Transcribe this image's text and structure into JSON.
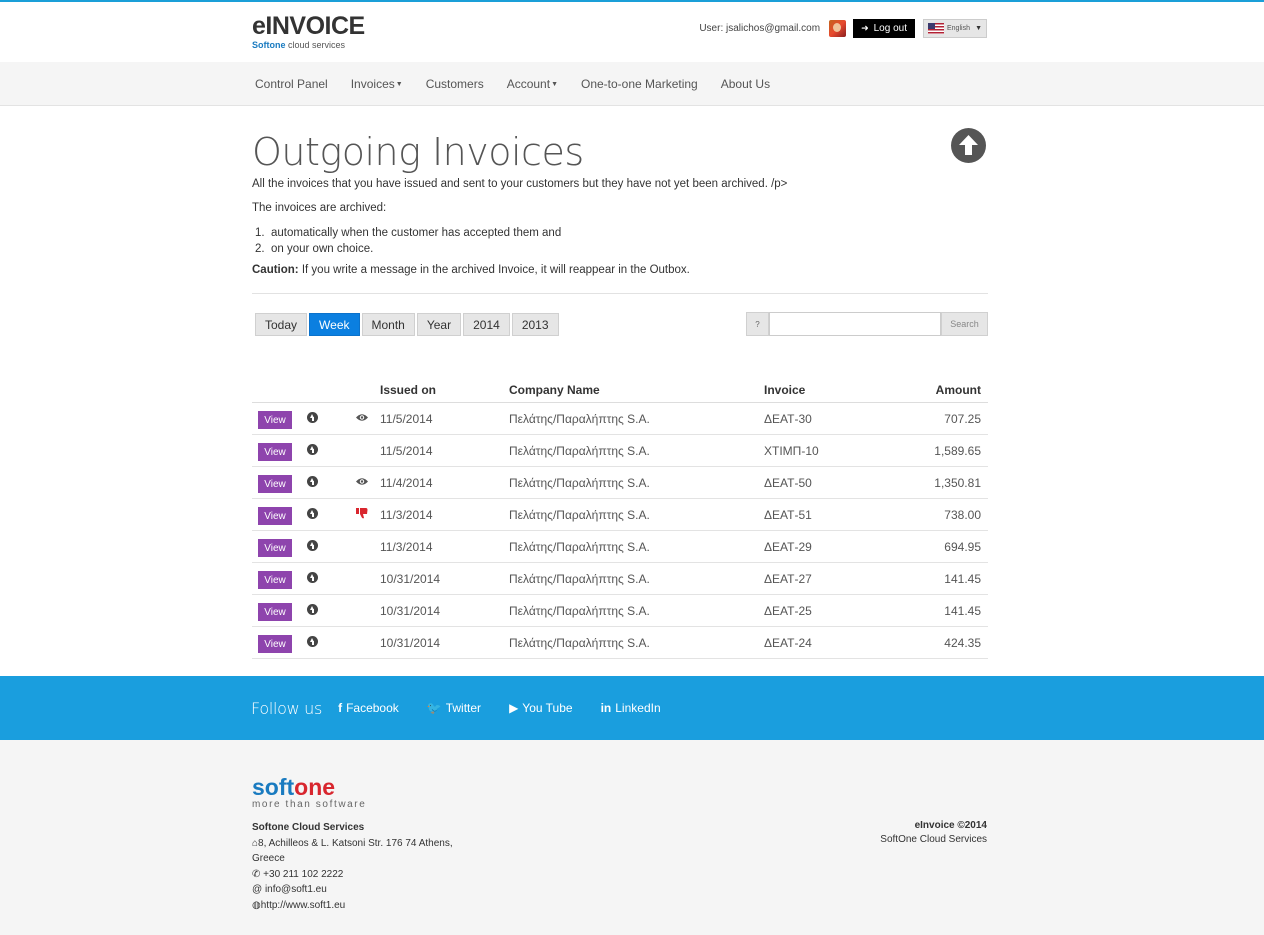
{
  "header": {
    "logo_main": "eINVOICE",
    "logo_sub_brand": "Softone",
    "logo_sub_text": "cloud services",
    "user_label": "User: jsalichos@gmail.com",
    "logout_label": "Log out",
    "language": "English"
  },
  "nav": {
    "items": [
      {
        "label": "Control Panel",
        "dropdown": false
      },
      {
        "label": "Invoices",
        "dropdown": true
      },
      {
        "label": "Customers",
        "dropdown": false
      },
      {
        "label": "Account",
        "dropdown": true
      },
      {
        "label": "One-to-one Marketing",
        "dropdown": false
      },
      {
        "label": "About Us",
        "dropdown": false
      }
    ]
  },
  "page": {
    "title": "Outgoing Invoices",
    "intro": "All the invoices that you have issued and sent to your customers but they have not yet been archived. /p>",
    "archived_intro": "The invoices are archived:",
    "list": [
      {
        "num": "1.",
        "text": "automatically when the customer has accepted them and"
      },
      {
        "num": "2.",
        "text": "on your own choice."
      }
    ],
    "caution_label": "Caution:",
    "caution_text": " If you write a message in the archived Invoice, it will reappear in the Outbox."
  },
  "filters": {
    "buttons": [
      "Today",
      "Week",
      "Month",
      "Year",
      "2014",
      "2013"
    ],
    "active": "Week",
    "help_label": "?",
    "search_value": "",
    "search_button": "Search"
  },
  "table": {
    "headers": {
      "issued_on": "Issued on",
      "company": "Company Name",
      "invoice": "Invoice",
      "amount": "Amount"
    },
    "view_label": "View",
    "rows": [
      {
        "status": "viewed",
        "date": "11/5/2014",
        "company": "Πελάτης/Παραλήπτης S.A.",
        "invoice": "ΔΕΑΤ-30",
        "amount": "707.25"
      },
      {
        "status": "none",
        "date": "11/5/2014",
        "company": "Πελάτης/Παραλήπτης S.A.",
        "invoice": "ΧΤΙΜΠ-10",
        "amount": "1,589.65"
      },
      {
        "status": "viewed",
        "date": "11/4/2014",
        "company": "Πελάτης/Παραλήπτης S.A.",
        "invoice": "ΔΕΑΤ-50",
        "amount": "1,350.81"
      },
      {
        "status": "rejected",
        "date": "11/3/2014",
        "company": "Πελάτης/Παραλήπτης S.A.",
        "invoice": "ΔΕΑΤ-51",
        "amount": "738.00"
      },
      {
        "status": "none",
        "date": "11/3/2014",
        "company": "Πελάτης/Παραλήπτης S.A.",
        "invoice": "ΔΕΑΤ-29",
        "amount": "694.95"
      },
      {
        "status": "none",
        "date": "10/31/2014",
        "company": "Πελάτης/Παραλήπτης S.A.",
        "invoice": "ΔΕΑΤ-27",
        "amount": "141.45"
      },
      {
        "status": "none",
        "date": "10/31/2014",
        "company": "Πελάτης/Παραλήπτης S.A.",
        "invoice": "ΔΕΑΤ-25",
        "amount": "141.45"
      },
      {
        "status": "none",
        "date": "10/31/2014",
        "company": "Πελάτης/Παραλήπτης S.A.",
        "invoice": "ΔΕΑΤ-24",
        "amount": "424.35"
      }
    ]
  },
  "follow": {
    "title": "Follow us",
    "links": [
      {
        "icon": "facebook-icon",
        "glyph": "f",
        "label": "Facebook"
      },
      {
        "icon": "twitter-icon",
        "glyph": "🐦",
        "label": "Twitter"
      },
      {
        "icon": "youtube-icon",
        "glyph": "▶",
        "label": "You Tube"
      },
      {
        "icon": "linkedin-icon",
        "glyph": "in",
        "label": "LinkedIn"
      }
    ]
  },
  "footer": {
    "logo_a": "soft",
    "logo_b": "one",
    "logo_sub": "more than software",
    "company": "Softone Cloud Services",
    "address": "8, Achilleos & L. Katsoni Str. 176 74 Athens,",
    "country": "Greece",
    "phone": "+30 211 102 2222",
    "email": "info@soft1.eu",
    "website": "http://www.soft1.eu",
    "copyright": "eInvoice ©2014",
    "copyright_sub": "SoftOne Cloud Services"
  },
  "colors": {
    "accent_blue": "#1a9ede",
    "active_button": "#0b7fe0",
    "view_button": "#8e44ad",
    "rejected_icon": "#d9262e"
  }
}
